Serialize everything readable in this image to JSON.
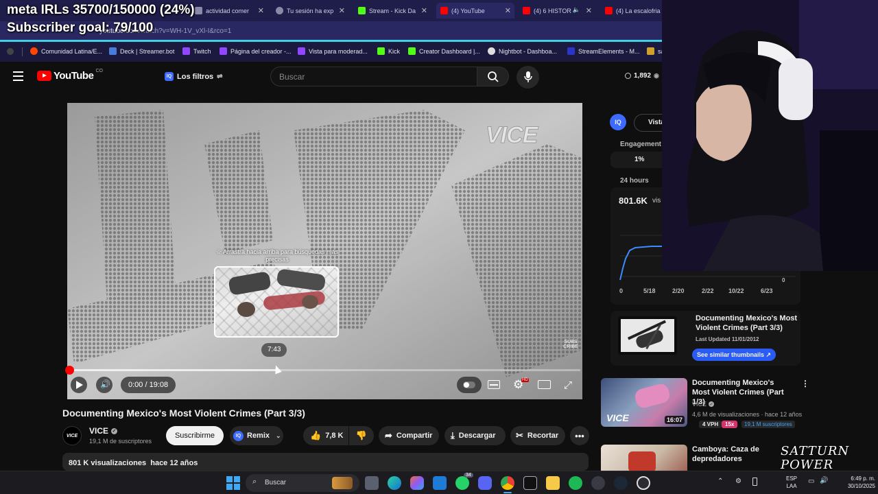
{
  "stream_overlay": {
    "goal_line": "meta IRLs 35700/150000 (24%)",
    "subscriber_goal": "Subscriber goal: 79/100"
  },
  "browser": {
    "tabs": [
      {
        "label": "actividad comer",
        "favicon_color": "#8a8aa8"
      },
      {
        "label": "Tu sesión ha exp",
        "favicon_color": "#8a8aa8"
      },
      {
        "label": "Stream - Kick Da",
        "favicon_color": "#53fc18"
      },
      {
        "label": "(4) YouTube",
        "favicon_color": "#ff0000"
      },
      {
        "label": "(4) 6 HISTOR",
        "favicon_color": "#ff0000"
      },
      {
        "label": "(4) La escalofria",
        "favicon_color": "#ff0000"
      }
    ],
    "url_host": "youtube.com",
    "url_path": "/watch?v=WH-1V_vXl-I&rco=1",
    "bookmarks": [
      {
        "label": "Comunidad Latina/E...",
        "favicon_color": "#ff4500"
      },
      {
        "label": "Deck | Streamer.bot",
        "favicon_color": "#4a7bd9"
      },
      {
        "label": "Twitch",
        "favicon_color": "#9146ff"
      },
      {
        "label": "Página del creador -...",
        "favicon_color": "#9146ff"
      },
      {
        "label": "Vista para moderad...",
        "favicon_color": "#9146ff"
      },
      {
        "label": "Kick",
        "favicon_color": "#53fc18"
      },
      {
        "label": "Creator Dashboard |...",
        "favicon_color": "#53fc18"
      },
      {
        "label": "Nightbot - Dashboa...",
        "favicon_color": "#dddddd"
      },
      {
        "label": "StreamElements - M...",
        "favicon_color": "#2d35c6"
      },
      {
        "label": "sa",
        "favicon_color": "#d1a02a"
      }
    ]
  },
  "youtube_header": {
    "logo_text": "YouTube",
    "logo_sup": "CO",
    "filters_label": "Los filtros",
    "search_placeholder": "Buscar",
    "count": "1,892"
  },
  "player": {
    "watermark": "VICE",
    "drag_hint": "☆ Arrastra hacia arriba para búsquedas más precisas",
    "preview_time": "7:43",
    "time_display": "0:00 / 19:08",
    "subscribe_stamp": "SUBSCRIBE",
    "progress_fraction": 0.0,
    "hover_fraction": 0.404,
    "hd_badge": "HD"
  },
  "video": {
    "title": "Documenting Mexico's Most Violent Crimes (Part 3/3)",
    "channel_logo": "VICE",
    "channel_name": "VICE",
    "subscribers": "19,1 M de suscriptores",
    "subscribe_label": "Suscribirme",
    "remix_label": "Remix",
    "likes": "7,8 K",
    "share_label": "Compartir",
    "download_label": "Descargar",
    "clip_label": "Recortar",
    "views_line": "801 K visualizaciones  hace 12 años"
  },
  "vidiq_panel": {
    "badge": "IQ",
    "tab_label": "Vista",
    "engagement_label": "Engagement",
    "engagement_value": "1%",
    "period_label": "24 hours",
    "views_value": "801.6K",
    "views_suffix": "vis",
    "chart_y_zero": "0",
    "chart_x_labels": [
      "0",
      "5/18",
      "2/20",
      "2/22",
      "10/22",
      "6/23"
    ],
    "thumb_card": {
      "title": "Documenting Mexico's Most Violent Crimes (Part 3/3)",
      "updated": "Last Updated 11/01/2012",
      "button": "See similar thumbnails ↗"
    }
  },
  "recommendations": [
    {
      "title": "Documenting Mexico's Most Violent Crimes (Part 1/3)",
      "channel": "VICE",
      "stats": "4,6 M de visualizaciones · hace 12 años",
      "duration": "16:07",
      "vph": "4 VPH",
      "multiplier": "15x",
      "subs": "19,1 M suscriptores",
      "thumb_watermark": "VICE"
    },
    {
      "title": "Camboya: Caza de depredadores",
      "channel": "",
      "stats": "",
      "duration": "",
      "vph": "",
      "multiplier": "",
      "subs": "",
      "thumb_watermark": ""
    }
  ],
  "streamer_logo": "SATTURN POWER",
  "taskbar": {
    "search_label": "Buscar",
    "lang_top": "ESP",
    "lang_bottom": "LAA",
    "time": "6:49 p. m.",
    "date": "30/10/2025",
    "discord_badge": "34"
  },
  "colors": {
    "youtube_red": "#ff0000",
    "vidiq_blue": "#3d6bff",
    "link_blue": "#3ea6ff",
    "multiplier_pink": "#d6336c"
  }
}
